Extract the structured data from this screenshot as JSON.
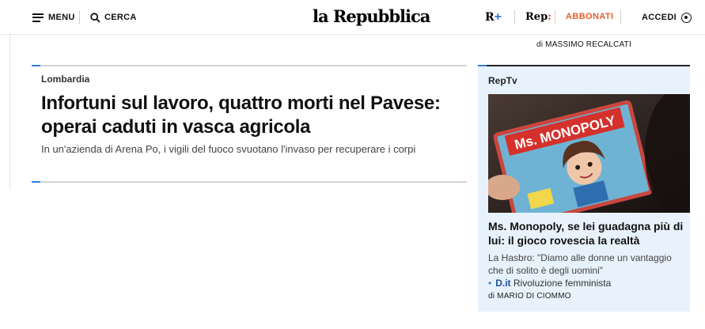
{
  "header": {
    "menu_label": "MENU",
    "search_label": "CERCA",
    "logo_text": "la Repubblica",
    "rplus_letter": "R",
    "rplus_plus": "+",
    "rep_text": "Rep",
    "rep_colon": ":",
    "subscribe_label": "ABBONATI",
    "login_label": "ACCEDI",
    "icons": {
      "menu": "hamburger-icon",
      "search": "search-icon",
      "login": "user-icon"
    }
  },
  "top_byline": {
    "prefix": "di",
    "author": "MASSIMO RECALCATI"
  },
  "main_article": {
    "kicker": "Lombardia",
    "headline": "Infortuni sul lavoro, quattro morti nel Pavese: operai caduti in vasca agricola",
    "summary": "In un'azienda di Arena Po, i vigili del fuoco svuotano l'invaso per recuperare i corpi"
  },
  "reptv": {
    "kicker": "RepTv",
    "image_text": "Ms. MONOPOLY",
    "title": "Ms. Monopoly, se lei guadagna più di lui: il gioco rovescia la realtà",
    "summary": "La Hasbro: \"Diamo alle donne un vantaggio che di solito è degli uomini\"",
    "related_bullet": "•",
    "related_brand": "D.it",
    "related_text": "Rivoluzione femminista",
    "byline": "di MARIO DI CIOMMO"
  },
  "colors": {
    "accent_blue": "#2f7fd6",
    "subscribe_orange": "#e2602a",
    "reptv_background": "#e8f2fc"
  }
}
